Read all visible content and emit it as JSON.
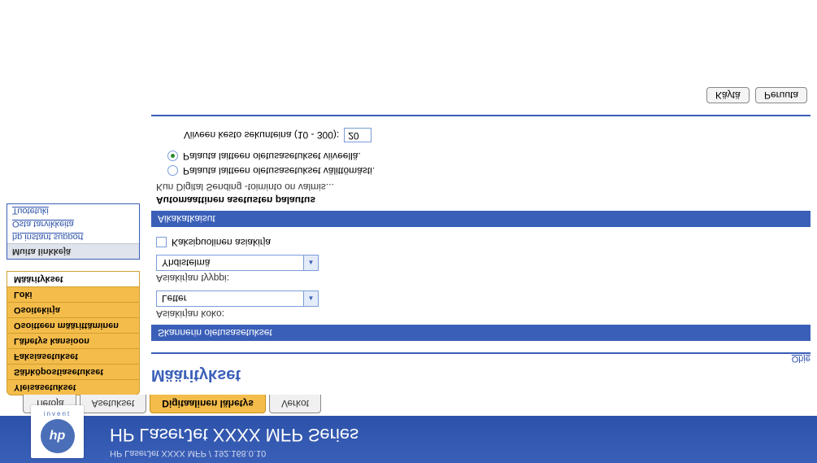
{
  "header": {
    "breadcrumb": "HP LaserJet XXXX MFP / 192.168.0.10",
    "product": "HP LaserJet XXXX MFP Series",
    "logo_text": "hp",
    "logo_sub": "invent"
  },
  "tabs": {
    "info": "Tietoja",
    "settings": "Asetukset",
    "digital": "Digitaalinen lähetys",
    "network": "Verkot"
  },
  "sidebar": {
    "general": "Yleisasetukset",
    "email": "Sähköpostiasetukset",
    "fax": "Faksiasetukset",
    "folder": "Lähetys kansioon",
    "addressing": "Osoitteen määrittäminen",
    "addrbook": "Osoitekirja",
    "log": "Loki",
    "prefs": "Määritykset"
  },
  "links": {
    "header": "Muita linkkejä",
    "instant": "hp instant support",
    "supplies": "Osta tarvikkeita",
    "support": "Tuotetuki"
  },
  "content": {
    "title": "Määritykset",
    "help": "Ohje",
    "section_scan": "Skannerin oletusasetukset",
    "doc_size_label": "Asiakirjan koko:",
    "doc_size_value": "Letter",
    "doc_type_label": "Asiakirjan tyyppi:",
    "doc_type_value": "Yhdistelmä",
    "duplex": "Kaksipuolinen asiakirja",
    "section_timeout": "Aikakatkaisut",
    "auto_reset_head": "Automaattinen asetusten palautus",
    "auto_reset_desc": "Kun Digital Sending -toiminto on valmis...",
    "radio_immediate": "Palauta laitteen oletusasetukset välittömästi.",
    "radio_delay": "Palauta laitteen oletusasetukset viiveellä.",
    "delay_label": "Viiveen kesto sekunteina (10 - 300):",
    "delay_value": "20",
    "apply": "Käytä",
    "cancel": "Peruuta"
  }
}
